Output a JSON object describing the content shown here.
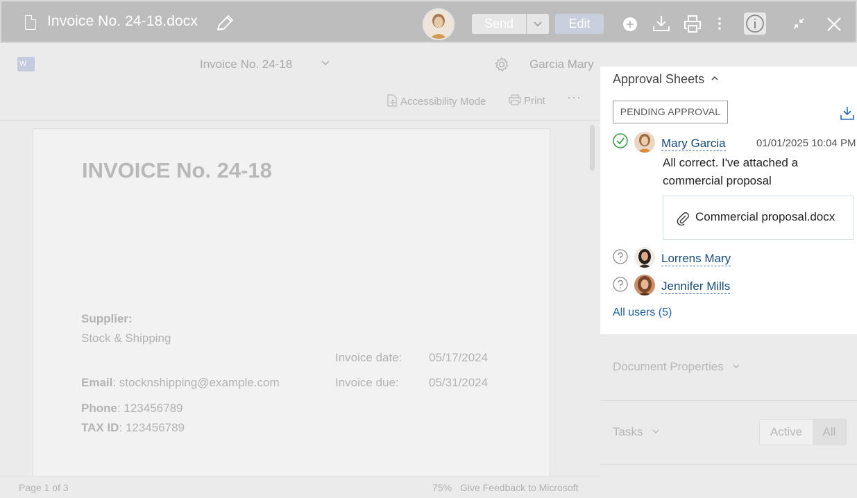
{
  "header": {
    "title": "Invoice No. 24-18.docx",
    "send_label": "Send",
    "edit_label": "Edit"
  },
  "viewer": {
    "app_logo": "W",
    "doc_name": "Invoice No. 24-18",
    "user_name": "Garcia Mary",
    "accessibility_label": "Accessibility Mode",
    "print_label": "Print",
    "more_label": "···",
    "page_status": "Page 1 of 3",
    "zoom": "75%",
    "feedback": "Give Feedback to Microsoft"
  },
  "document": {
    "title": "INVOICE No. 24-18",
    "supplier_label": "Supplier:",
    "supplier_name": "Stock & Shipping",
    "email_label": "Email",
    "email_value": ": stocknshipping@example.com",
    "phone_label": "Phone",
    "phone_value": ": 123456789",
    "tax_label": "TAX ID",
    "tax_value": ": 123456789",
    "invoice_date_label": "Invoice date:",
    "invoice_date": "05/17/2024",
    "invoice_due_label": "Invoice due:",
    "invoice_due": "05/31/2024"
  },
  "approval": {
    "heading": "Approval Sheets",
    "status": "PENDING APPROVAL",
    "approvers": [
      {
        "name": "Mary Garcia",
        "timestamp": "01/01/2025 10:04 PM",
        "comment": "All correct. I've attached a commercial proposal",
        "attachment": "Commercial proposal.docx",
        "state": "approved"
      },
      {
        "name": "Lorrens Mary",
        "state": "pending"
      },
      {
        "name": "Jennifer Mills",
        "state": "pending"
      }
    ],
    "all_users": "All users (5)"
  },
  "properties_label": "Document Properties",
  "tasks": {
    "label": "Tasks",
    "filter_active": "Active",
    "filter_all": "All"
  },
  "colors": {
    "header_bg": "#bdbdbd",
    "link": "#164a78",
    "approved": "#2e9e3e"
  }
}
